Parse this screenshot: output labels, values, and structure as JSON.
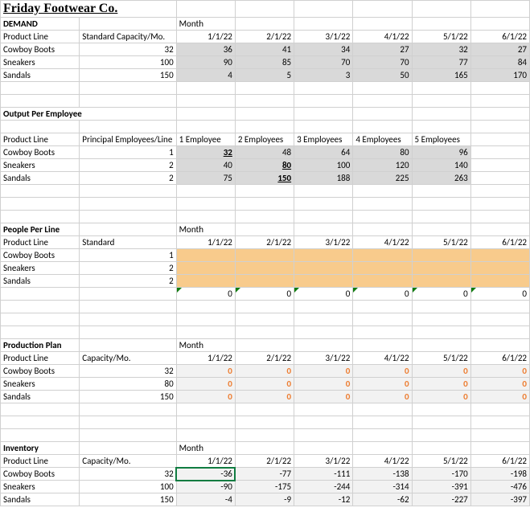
{
  "title": "Friday Footwear Co.",
  "sections": {
    "demand": {
      "header": "DEMAND",
      "monthLabel": "Month",
      "col1": "Product Line",
      "col2": "Standard Capacity/Mo.",
      "months": [
        "1/1/22",
        "2/1/22",
        "3/1/22",
        "4/1/22",
        "5/1/22",
        "6/1/22"
      ],
      "rows": [
        {
          "name": "Cowboy Boots",
          "cap": "32",
          "vals": [
            "36",
            "41",
            "34",
            "27",
            "32",
            "27"
          ]
        },
        {
          "name": "Sneakers",
          "cap": "100",
          "vals": [
            "90",
            "85",
            "70",
            "70",
            "77",
            "84"
          ]
        },
        {
          "name": "Sandals",
          "cap": "150",
          "vals": [
            "4",
            "5",
            "3",
            "50",
            "165",
            "170"
          ]
        }
      ]
    },
    "output": {
      "header": "Output Per Employee",
      "col1": "Product Line",
      "col2": "Principal Employees/Line",
      "cols": [
        "1 Employee",
        "2 Employees",
        "3 Employees",
        "4 Employees",
        "5 Employees"
      ],
      "rows": [
        {
          "name": "Cowboy Boots",
          "pe": "1",
          "vals": [
            "32",
            "48",
            "64",
            "80",
            "96"
          ],
          "boldIdx": 0
        },
        {
          "name": "Sneakers",
          "pe": "2",
          "vals": [
            "40",
            "80",
            "100",
            "120",
            "140"
          ],
          "boldIdx": 1
        },
        {
          "name": "Sandals",
          "pe": "2",
          "vals": [
            "75",
            "150",
            "188",
            "225",
            "263"
          ],
          "boldIdx": 1
        }
      ]
    },
    "people": {
      "header": "People Per Line",
      "monthLabel": "Month",
      "col1": "Product Line",
      "col2": "Standard",
      "months": [
        "1/1/22",
        "2/1/22",
        "3/1/22",
        "4/1/22",
        "5/1/22",
        "6/1/22"
      ],
      "rows": [
        {
          "name": "Cowboy Boots",
          "std": "1"
        },
        {
          "name": "Sneakers",
          "std": "2"
        },
        {
          "name": "Sandals",
          "std": "2"
        }
      ],
      "totals": [
        "0",
        "0",
        "0",
        "0",
        "0",
        "0"
      ]
    },
    "plan": {
      "header": "Production Plan",
      "monthLabel": "Month",
      "col1": "Product Line",
      "col2": "Capacity/Mo.",
      "months": [
        "1/1/22",
        "2/1/22",
        "3/1/22",
        "4/1/22",
        "5/1/22",
        "6/1/22"
      ],
      "rows": [
        {
          "name": "Cowboy Boots",
          "cap": "32",
          "vals": [
            "0",
            "0",
            "0",
            "0",
            "0",
            "0"
          ]
        },
        {
          "name": "Sneakers",
          "cap": "80",
          "vals": [
            "0",
            "0",
            "0",
            "0",
            "0",
            "0"
          ]
        },
        {
          "name": "Sandals",
          "cap": "150",
          "vals": [
            "0",
            "0",
            "0",
            "0",
            "0",
            "0"
          ]
        }
      ]
    },
    "inventory": {
      "header": "Inventory",
      "monthLabel": "Month",
      "col1": "Product Line",
      "col2": "Capacity/Mo.",
      "months": [
        "1/1/22",
        "2/1/22",
        "3/1/22",
        "4/1/22",
        "5/1/22",
        "6/1/22"
      ],
      "rows": [
        {
          "name": "Cowboy Boots",
          "cap": "32",
          "vals": [
            "-36",
            "-77",
            "-111",
            "-138",
            "-170",
            "-198"
          ]
        },
        {
          "name": "Sneakers",
          "cap": "100",
          "vals": [
            "-90",
            "-175",
            "-244",
            "-314",
            "-391",
            "-476"
          ]
        },
        {
          "name": "Sandals",
          "cap": "150",
          "vals": [
            "-4",
            "-9",
            "-12",
            "-62",
            "-227",
            "-397"
          ]
        }
      ]
    }
  }
}
